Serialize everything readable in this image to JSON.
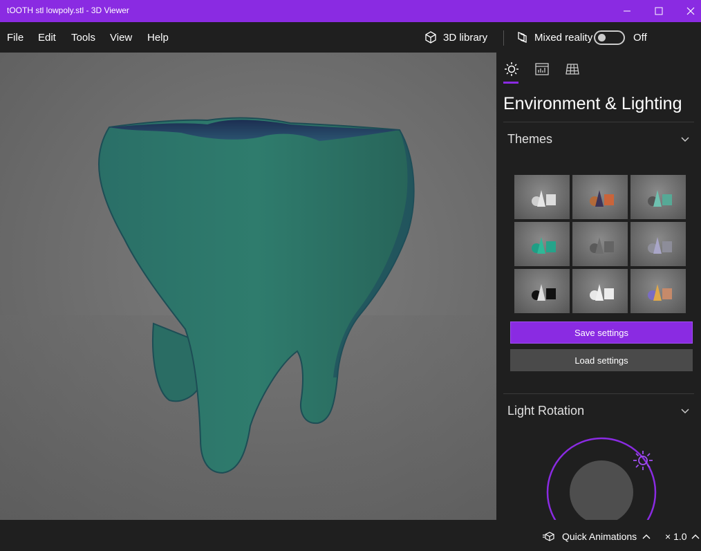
{
  "window": {
    "title": "tOOTH stl lowpoly.stl - 3D Viewer"
  },
  "menu": {
    "items": [
      "File",
      "Edit",
      "Tools",
      "View",
      "Help"
    ],
    "library_label": "3D library",
    "mixed_reality_label": "Mixed reality",
    "mixed_reality_state": "Off",
    "mixed_reality_on": false
  },
  "panel": {
    "tabs": [
      {
        "name": "environment-lighting",
        "icon": "sun-icon",
        "active": true
      },
      {
        "name": "stats-shading",
        "icon": "stats-chart-icon",
        "active": false
      },
      {
        "name": "mesh",
        "icon": "grid-icon",
        "active": false
      }
    ],
    "title": "Environment & Lighting",
    "themes_heading": "Themes",
    "save_label": "Save settings",
    "load_label": "Load settings",
    "light_rotation_heading": "Light Rotation"
  },
  "status": {
    "quick_animations_label": "Quick Animations",
    "speed_label": "× 1.0"
  },
  "colors": {
    "accent": "#8a2be2",
    "model": "#2d7a6e"
  }
}
